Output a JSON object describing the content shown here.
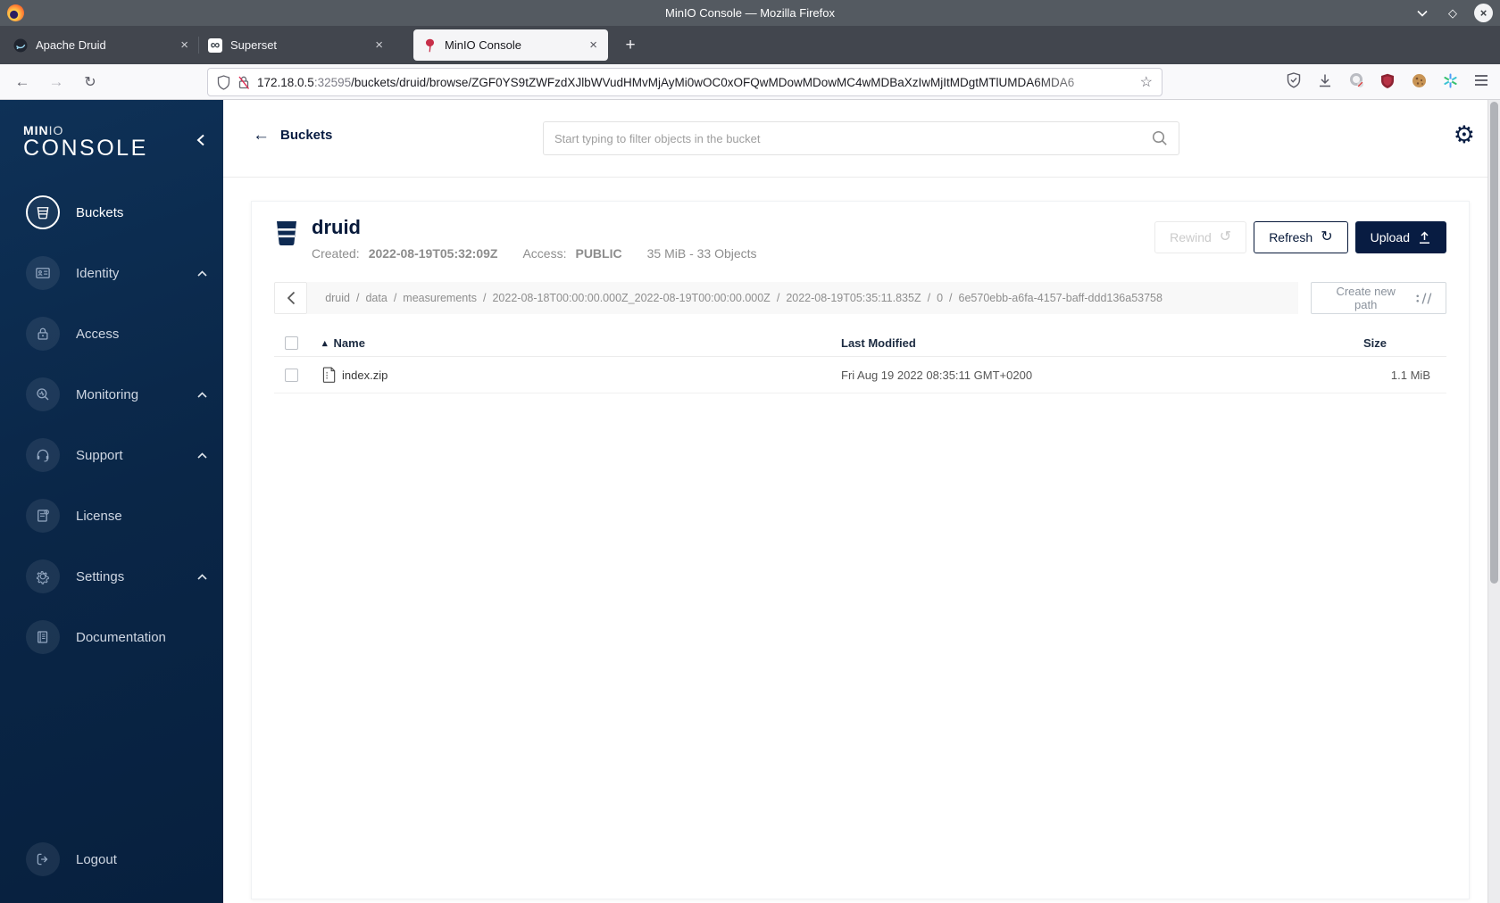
{
  "window": {
    "title": "MinIO Console — Mozilla Firefox"
  },
  "browser": {
    "tabs": [
      {
        "label": "Apache Druid"
      },
      {
        "label": "Superset"
      },
      {
        "label": "MinIO Console"
      }
    ],
    "url": {
      "host": "172.18.0.5",
      "port": ":32595",
      "path": "/buckets/druid/browse/ZGF0YS9tZWFzdXJlbWVudHMvMjAyMi0wOC0xOFQwMDowMDowMC4wMDBaXzIwMjItMDgtMTlUMDA6MDA6"
    }
  },
  "icons": {
    "back_arrow": "←",
    "forward_arrow": "→",
    "reload": "↻",
    "bookmark_star": "☆",
    "window_max": "◇",
    "window_close": "×",
    "close_tab": "×",
    "new_tab": "+",
    "superset": "∞",
    "gear": "⚙",
    "refresh": "↻",
    "rewind": "↺",
    "sort_asc": "▴"
  },
  "sidebar": {
    "logo_part1": "MIN",
    "logo_part2": "IO",
    "logo_line2": "CONSOLE",
    "items": [
      {
        "label": "Buckets"
      },
      {
        "label": "Identity"
      },
      {
        "label": "Access"
      },
      {
        "label": "Monitoring"
      },
      {
        "label": "Support"
      },
      {
        "label": "License"
      },
      {
        "label": "Settings"
      },
      {
        "label": "Documentation"
      }
    ],
    "logout_label": "Logout"
  },
  "header": {
    "back_label": "Buckets",
    "search_placeholder": "Start typing to filter objects in the bucket"
  },
  "bucket": {
    "name": "druid",
    "created_label": "Created:",
    "created_value": "2022-08-19T05:32:09Z",
    "access_label": "Access:",
    "access_value": "PUBLIC",
    "summary": "35 MiB - 33 Objects"
  },
  "actions": {
    "rewind": "Rewind",
    "refresh": "Refresh",
    "upload": "Upload",
    "create_path": "Create new path"
  },
  "breadcrumb": {
    "separator": "/",
    "segments": [
      "druid",
      "data",
      "measurements",
      "2022-08-18T00:00:00.000Z_2022-08-19T00:00:00.000Z",
      "2022-08-19T05:35:11.835Z",
      "0",
      "6e570ebb-a6fa-4157-baff-ddd136a53758"
    ]
  },
  "table": {
    "columns": [
      "Name",
      "Last Modified",
      "Size"
    ],
    "rows": [
      {
        "name": "index.zip",
        "modified": "Fri Aug 19 2022 08:35:11 GMT+0200",
        "size": "1.1 MiB"
      }
    ]
  },
  "colors": {
    "brand_navy": "#081C42",
    "sidebar_top": "#0e3157",
    "sidebar_bottom": "#07203e",
    "minio_red": "#C72E49",
    "disabled_text": "#cbcbcb",
    "titlebar": "#545a61"
  }
}
